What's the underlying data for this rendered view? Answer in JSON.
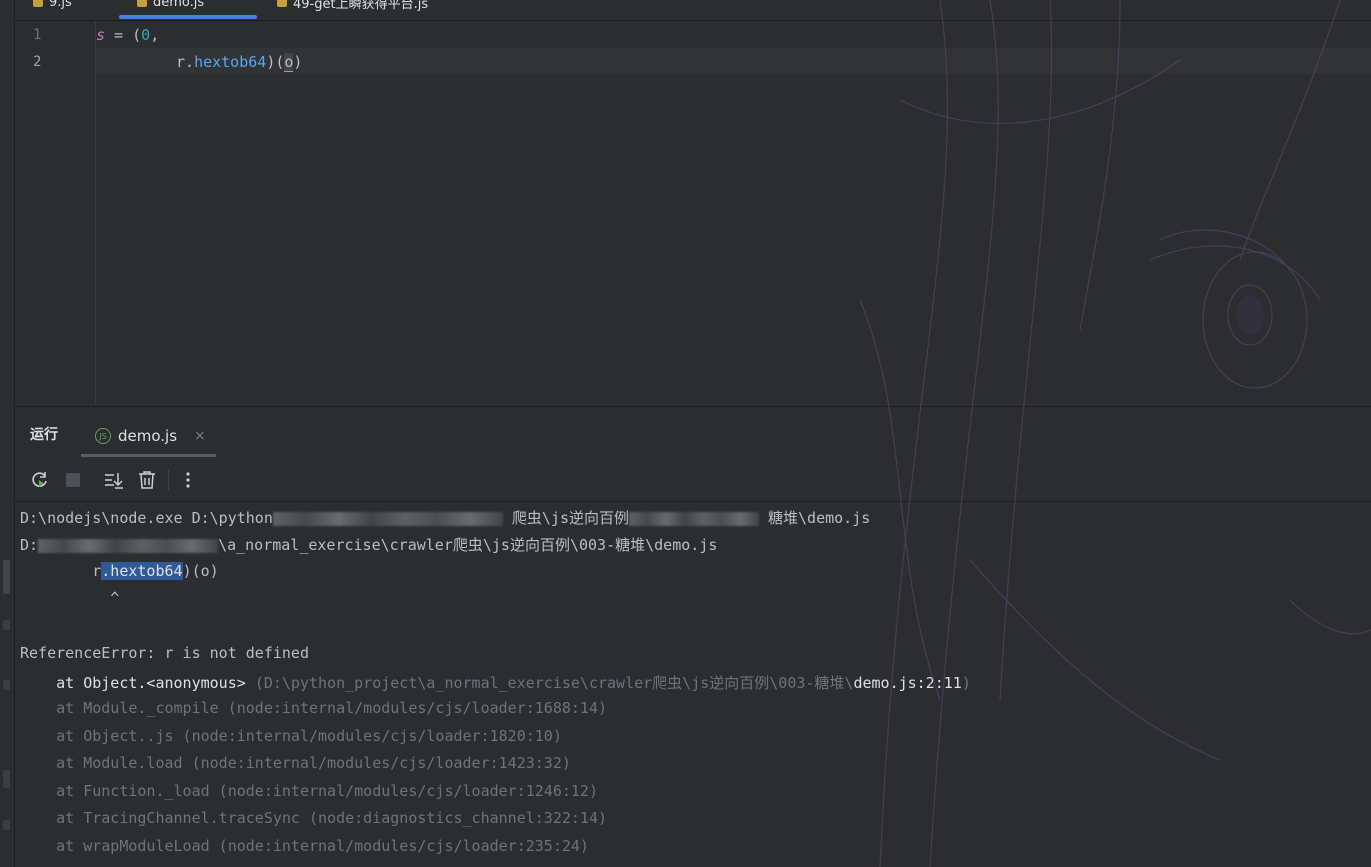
{
  "colors": {
    "background": "#2b2d30",
    "accent": "#4a7de8",
    "selection": "#2f5a98",
    "method": "#56a8f5",
    "number": "#2aacb8",
    "keyword": "#c77dbb"
  },
  "editor_tabs": [
    {
      "label": "9.js",
      "icon": "js-file-icon"
    },
    {
      "label": "demo.js",
      "icon": "js-file-icon",
      "active": true
    },
    {
      "label": "49-get上瞬获得平台.js",
      "icon": "js-file-icon"
    }
  ],
  "editor": {
    "line_numbers": [
      "1",
      "2"
    ],
    "line1": {
      "var": "s",
      "eq": " = ",
      "open": "(",
      "num": "0",
      "rest": ","
    },
    "line2": {
      "obj": "r",
      "dot": ".",
      "method": "hextob64",
      "call": ")(",
      "arg": "o",
      "close": ")"
    }
  },
  "run_panel": {
    "title": "运行",
    "tab_label": "demo.js",
    "tab_icon": "nodejs-icon",
    "close_glyph": "×"
  },
  "toolbar": {
    "rerun_icon": "rerun-icon",
    "stop_icon": "stop-icon",
    "scroll_to_end_icon": "scroll-to-end-icon",
    "clear_icon": "trash-icon",
    "more_icon": "more-vertical-icon"
  },
  "console": {
    "cmd_start": "D:\\nodejs\\node.exe D:\\python",
    "cmd_mid": "爬虫\\js逆向百例",
    "cmd_end": "糖堆\\demo.js",
    "path_start": "D:",
    "path_mid": "\\a_normal_exercise\\crawler爬虫\\js逆向百例\\003-糖堆\\demo.js",
    "code_prefix": "        r",
    "code_sel": ".hextob64",
    "code_suffix": ")(o)",
    "caret": "          ^",
    "error": "ReferenceError: r is not defined",
    "stack_top_prefix": "    at Object.<anonymous> ",
    "stack_top_path": "(D:\\python_project\\a_normal_exercise\\crawler爬虫\\js逆向百例\\003-糖堆\\",
    "stack_top_link": "demo.js:2:11",
    "stack_top_close": ")",
    "stack": [
      "    at Module._compile (node:internal/modules/cjs/loader:1688:14)",
      "    at Object..js (node:internal/modules/cjs/loader:1820:10)",
      "    at Module.load (node:internal/modules/cjs/loader:1423:32)",
      "    at Function._load (node:internal/modules/cjs/loader:1246:12)",
      "    at TracingChannel.traceSync (node:diagnostics_channel:322:14)",
      "    at wrapModuleLoad (node:internal/modules/cjs/loader:235:24)"
    ]
  }
}
